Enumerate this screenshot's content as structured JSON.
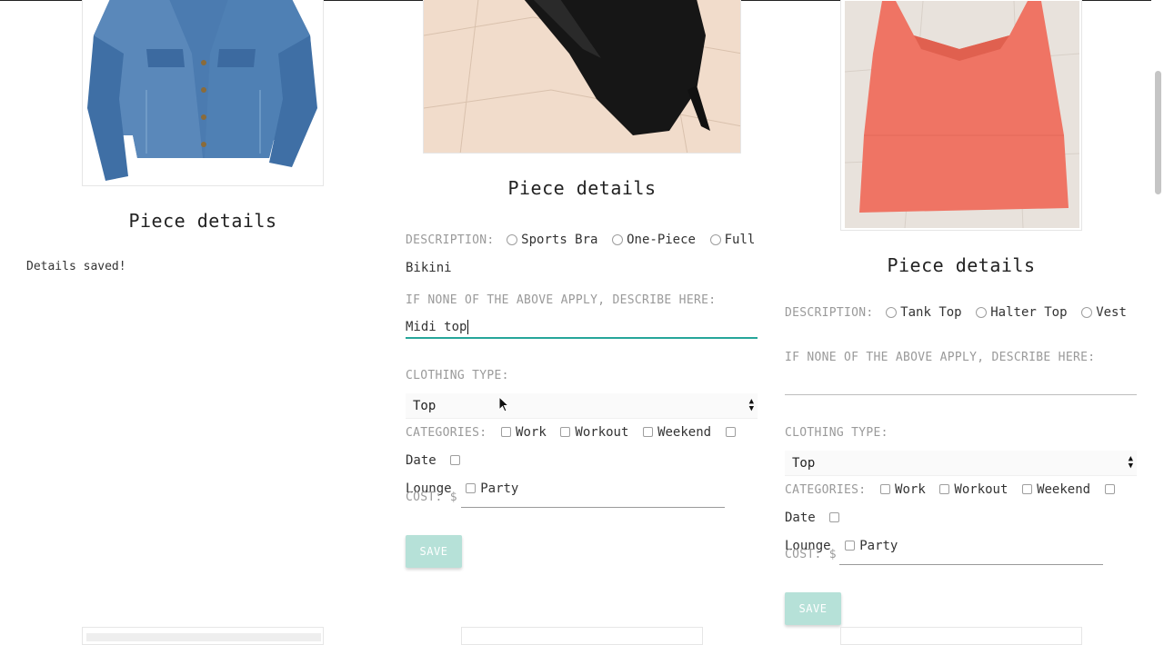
{
  "col1": {
    "title": "Piece details",
    "saved_text": "Details saved!"
  },
  "col2": {
    "title": "Piece details",
    "description_label": "DESCRIPTION:",
    "options": [
      "Sports Bra",
      "One-Piece",
      "Full",
      "Bikini"
    ],
    "other_label": "IF NONE OF THE ABOVE APPLY, DESCRIBE HERE:",
    "other_value": "Midi top",
    "type_label": "CLOTHING TYPE:",
    "type_value": "Top",
    "categories_label": "CATEGORIES:",
    "categories": [
      "Work",
      "Workout",
      "Weekend",
      "Date",
      "Lounge",
      "Party"
    ],
    "cost_label": "COST: $",
    "save_label": "SAVE"
  },
  "col3": {
    "title": "Piece details",
    "description_label": "DESCRIPTION:",
    "options": [
      "Tank Top",
      "Halter Top",
      "Vest"
    ],
    "other_label": "IF NONE OF THE ABOVE APPLY, DESCRIBE HERE:",
    "type_label": "CLOTHING TYPE:",
    "type_value": "Top",
    "categories_label": "CATEGORIES:",
    "categories": [
      "Work",
      "Workout",
      "Weekend",
      "Date",
      "Lounge",
      "Party"
    ],
    "cost_label": "COST: $",
    "save_label": "SAVE"
  }
}
